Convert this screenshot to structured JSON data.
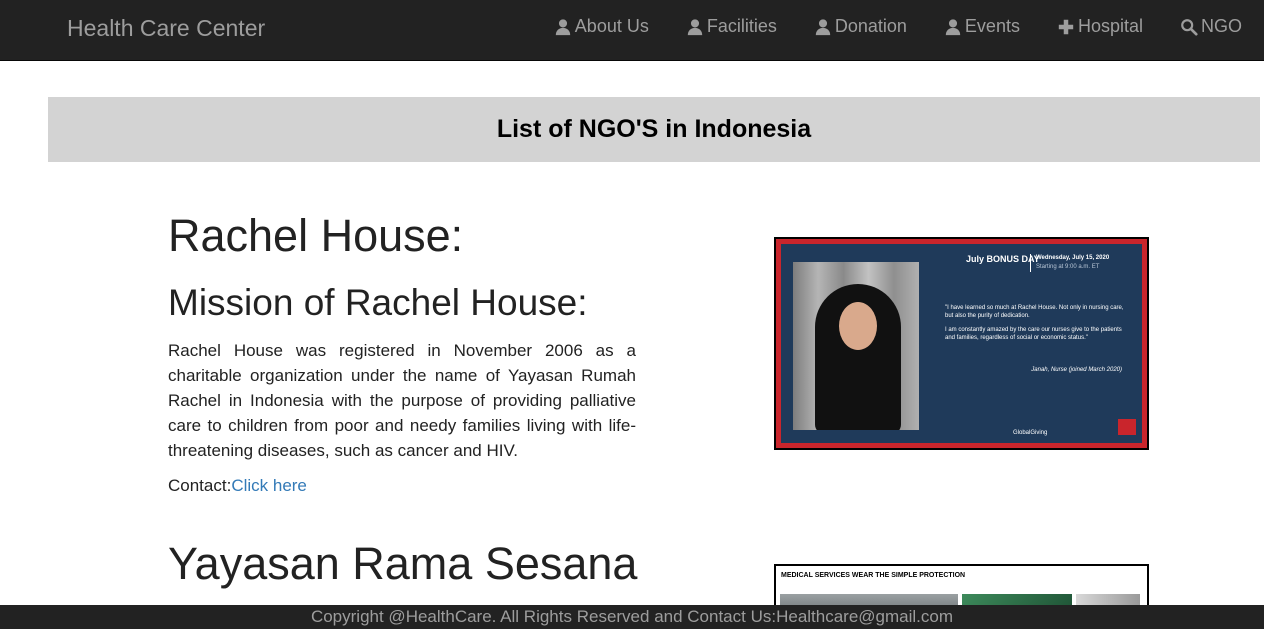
{
  "navbar": {
    "brand": "Health Care Center",
    "items": [
      {
        "label": "About Us",
        "icon": "user-icon"
      },
      {
        "label": "Facilities",
        "icon": "user-icon"
      },
      {
        "label": "Donation",
        "icon": "user-icon"
      },
      {
        "label": "Events",
        "icon": "user-icon"
      },
      {
        "label": "Hospital",
        "icon": "plus-icon"
      },
      {
        "label": "NGO",
        "icon": "search-icon"
      }
    ]
  },
  "banner": {
    "title": "List of NGO'S in Indonesia"
  },
  "ngos": [
    {
      "name": "Rachel House:",
      "mission_title": "Mission of Rachel House:",
      "description": "Rachel House was registered in November 2006 as a charitable organization under the name of Yayasan Rumah Rachel in Indonesia with the purpose of providing palliative care to children from poor and needy families living with life-threatening diseases, such as cancer and HIV.",
      "contact_label": "Contact:",
      "contact_link": "Click here",
      "image": {
        "badge": "July BONUS DAY",
        "date": "Wednesday, July 15, 2020",
        "time": "Starting at 9:00 a.m. ET",
        "quote1": "\"I have learned so much at Rachel House. Not only in nursing care, but also the purity of dedication.",
        "quote2": "I am constantly amazed by the care our nurses give to the patients and families, regardless of social or economic status.\"",
        "signature": "Janah, Nurse (joined March 2020)",
        "brand": "GlobalGiving"
      }
    },
    {
      "name": "Yayasan Rama Sesana",
      "image": {
        "caption": "MEDICAL SERVICES WEAR THE SIMPLE PROTECTION"
      }
    }
  ],
  "footer": {
    "text": "Copyright @HealthCare. All Rights Reserved and Contact Us:Healthcare@gmail.com"
  }
}
